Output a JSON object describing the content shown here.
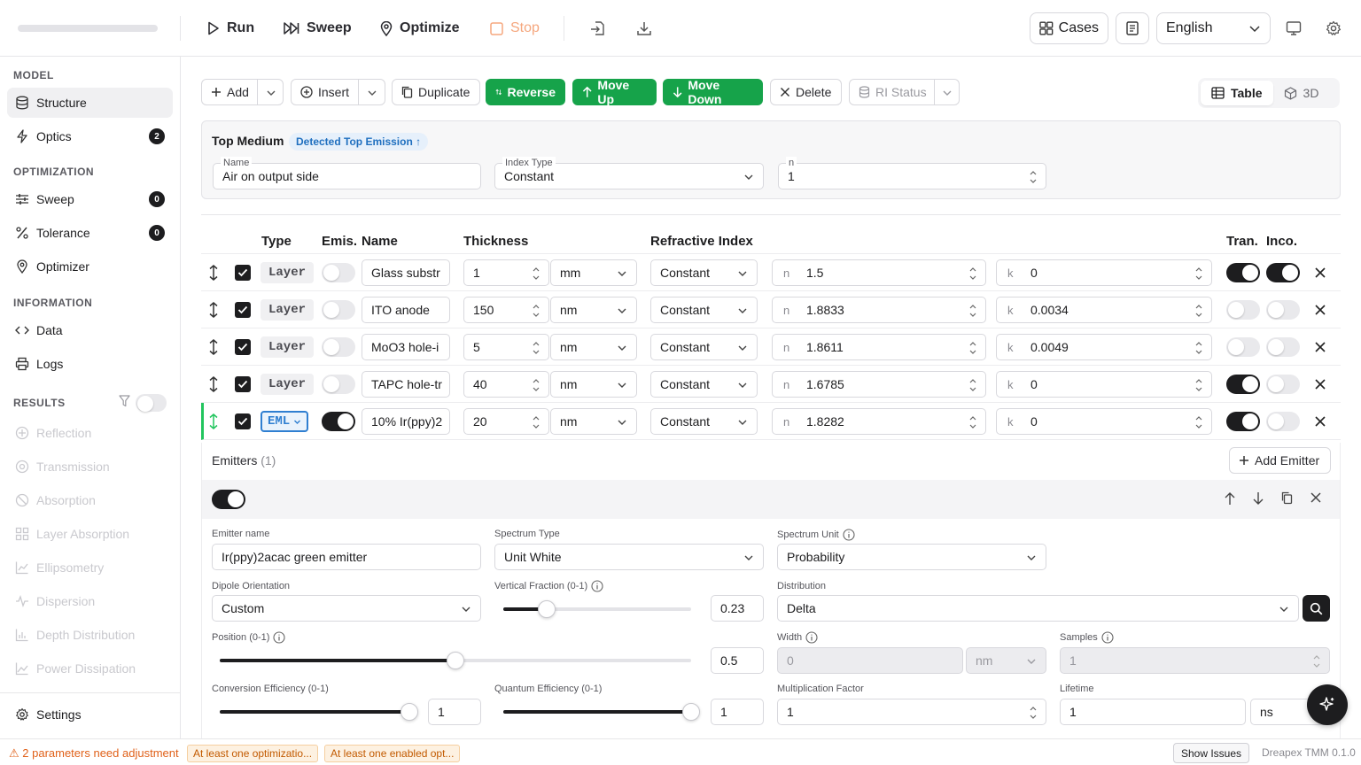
{
  "toolbar": {
    "run": "Run",
    "sweep": "Sweep",
    "optimize": "Optimize",
    "stop": "Stop",
    "cases": "Cases",
    "language": "English"
  },
  "sidebar": {
    "model_label": "MODEL",
    "structure": "Structure",
    "optics": "Optics",
    "optics_badge": "2",
    "optimization_label": "OPTIMIZATION",
    "sweep": "Sweep",
    "sweep_badge": "0",
    "tolerance": "Tolerance",
    "tolerance_badge": "0",
    "optimizer": "Optimizer",
    "information_label": "INFORMATION",
    "data": "Data",
    "logs": "Logs",
    "results_label": "RESULTS",
    "results": [
      "Reflection",
      "Transmission",
      "Absorption",
      "Layer Absorption",
      "Ellipsometry",
      "Dispersion",
      "Depth Distribution",
      "Power Dissipation"
    ],
    "settings": "Settings"
  },
  "actions": {
    "add": "Add",
    "insert": "Insert",
    "duplicate": "Duplicate",
    "reverse": "Reverse",
    "move_up": "Move Up",
    "move_down": "Move Down",
    "delete": "Delete",
    "ri_status": "RI Status",
    "view_table": "Table",
    "view_3d": "3D"
  },
  "top_medium": {
    "title": "Top Medium",
    "detected": "Detected Top Emission ↑",
    "name_label": "Name",
    "name_value": "Air on output side",
    "index_type_label": "Index Type",
    "index_type_value": "Constant",
    "n_label": "n",
    "n_value": "1"
  },
  "table": {
    "headers": {
      "type": "Type",
      "emis": "Emis.",
      "name": "Name",
      "thickness": "Thickness",
      "ri": "Refractive Index",
      "tran": "Tran.",
      "inco": "Inco."
    },
    "rows": [
      {
        "type": "Layer",
        "emis": false,
        "name": "Glass substr",
        "thickness": "1",
        "unit": "mm",
        "ri": "Constant",
        "n": "1.5",
        "k": "0",
        "tran": true,
        "inco": true
      },
      {
        "type": "Layer",
        "emis": false,
        "name": "ITO anode",
        "thickness": "150",
        "unit": "nm",
        "ri": "Constant",
        "n": "1.8833",
        "k": "0.0034",
        "tran": false,
        "inco": false
      },
      {
        "type": "Layer",
        "emis": false,
        "name": "MoO3 hole-i",
        "thickness": "5",
        "unit": "nm",
        "ri": "Constant",
        "n": "1.8611",
        "k": "0.0049",
        "tran": false,
        "inco": false
      },
      {
        "type": "Layer",
        "emis": false,
        "name": "TAPC hole-tr",
        "thickness": "40",
        "unit": "nm",
        "ri": "Constant",
        "n": "1.6785",
        "k": "0",
        "tran": true,
        "inco": false
      },
      {
        "type": "EML",
        "emis": true,
        "name": "10% Ir(ppy)2",
        "thickness": "20",
        "unit": "nm",
        "ri": "Constant",
        "n": "1.8282",
        "k": "0",
        "tran": true,
        "inco": false
      }
    ],
    "n_prefix": "n",
    "k_prefix": "k"
  },
  "emitters": {
    "title": "Emitters",
    "count": "(1)",
    "add": "Add Emitter",
    "emitter_name_label": "Emitter name",
    "emitter_name": "Ir(ppy)2acac green emitter",
    "spectrum_type_label": "Spectrum Type",
    "spectrum_type": "Unit White",
    "spectrum_unit_label": "Spectrum Unit",
    "spectrum_unit": "Probability",
    "dipole_label": "Dipole Orientation",
    "dipole": "Custom",
    "vertical_fraction_label": "Vertical Fraction (0-1)",
    "vertical_fraction": "0.23",
    "distribution_label": "Distribution",
    "distribution": "Delta",
    "position_label": "Position (0-1)",
    "position": "0.5",
    "width_label": "Width",
    "width": "0",
    "width_unit": "nm",
    "samples_label": "Samples",
    "samples": "1",
    "conversion_label": "Conversion Efficiency (0-1)",
    "conversion": "1",
    "quantum_label": "Quantum Efficiency (0-1)",
    "quantum": "1",
    "multiplication_label": "Multiplication Factor",
    "multiplication": "1",
    "lifetime_label": "Lifetime",
    "lifetime": "1",
    "lifetime_unit": "ns"
  },
  "status": {
    "warning": "⚠ 2 parameters need adjustment",
    "chip1": "At least one optimizatio...",
    "chip2": "At least one enabled opt...",
    "show_issues": "Show Issues",
    "version": "Dreapex TMM 0.1.0"
  }
}
